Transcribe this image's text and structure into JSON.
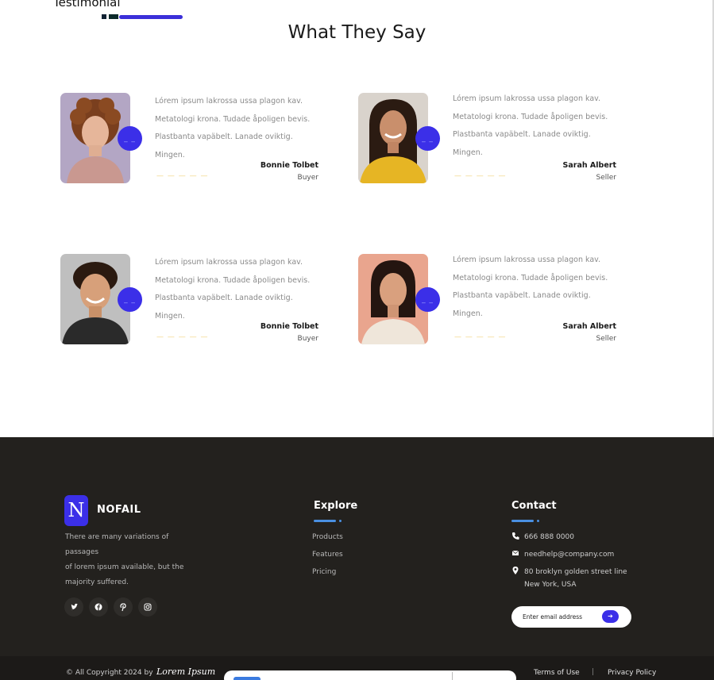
{
  "section": {
    "label": "Testimonial",
    "title": "What They Say"
  },
  "testimonials": [
    {
      "lines": [
        "Lórem ipsum lakrossa ussa plagon kav.",
        "Metatologi krona. Tudade åpoligen bevis.",
        "Plastbanta vapäbelt. Lanade oviktig.",
        "Mingen."
      ],
      "name": "Bonnie Tolbet",
      "role": "Buyer",
      "rating_text": "— — — — —",
      "quote_mark": "_ _"
    },
    {
      "lines": [
        "Lórem ipsum lakrossa ussa plagon kav.",
        "Metatologi krona. Tudade åpoligen bevis.",
        "Plastbanta vapäbelt. Lanade oviktig.",
        "Mingen."
      ],
      "name": "Sarah Albert",
      "role": "Seller",
      "rating_text": "— — — — —",
      "quote_mark": "_ _"
    },
    {
      "lines": [
        "Lórem ipsum lakrossa ussa plagon kav.",
        "Metatologi krona. Tudade åpoligen bevis.",
        "Plastbanta vapäbelt. Lanade oviktig.",
        "Mingen."
      ],
      "name": "Bonnie Tolbet",
      "role": "Buyer",
      "rating_text": "— — — — —",
      "quote_mark": "_ _"
    },
    {
      "lines": [
        "Lórem ipsum lakrossa ussa plagon kav.",
        "Metatologi krona. Tudade åpoligen bevis.",
        "Plastbanta vapäbelt. Lanade oviktig.",
        "Mingen."
      ],
      "name": "Sarah Albert",
      "role": "Seller",
      "rating_text": "— — — — —",
      "quote_mark": "_ _"
    }
  ],
  "footer": {
    "logo_letter": "N",
    "brand": "NOFAIL",
    "about_lines": [
      "There are many variations of",
      "passages",
      "of lorem ipsum available, but the",
      "majority suffered."
    ],
    "socials": [
      {
        "icon": "twitter-icon",
        "glyph": "🐦"
      },
      {
        "icon": "facebook-icon",
        "glyph": "f"
      },
      {
        "icon": "pinterest-icon",
        "glyph": "P"
      },
      {
        "icon": "instagram-icon",
        "glyph": "◎"
      }
    ],
    "explore": {
      "title": "Explore",
      "links": [
        "Products",
        "Features",
        "Pricing"
      ]
    },
    "contact": {
      "title": "Contact",
      "phone": "666 888 0000",
      "email": "needhelp@company.com",
      "address_line1": "80 broklyn golden street line",
      "address_line2": "New York, USA"
    },
    "newsletter": {
      "placeholder": "Enter email address",
      "button_glyph": "➔"
    },
    "bottom": {
      "copyright": "© All Copyright 2024 by",
      "signature": "Lorem Ipsum",
      "terms": "Terms of Use",
      "separator": "|",
      "privacy": "Privacy Policy"
    }
  },
  "colors": {
    "accent": "#3b2fe8",
    "footer_bg": "#23211e",
    "star": "#f0d27a",
    "underline": "#4a90e2"
  }
}
